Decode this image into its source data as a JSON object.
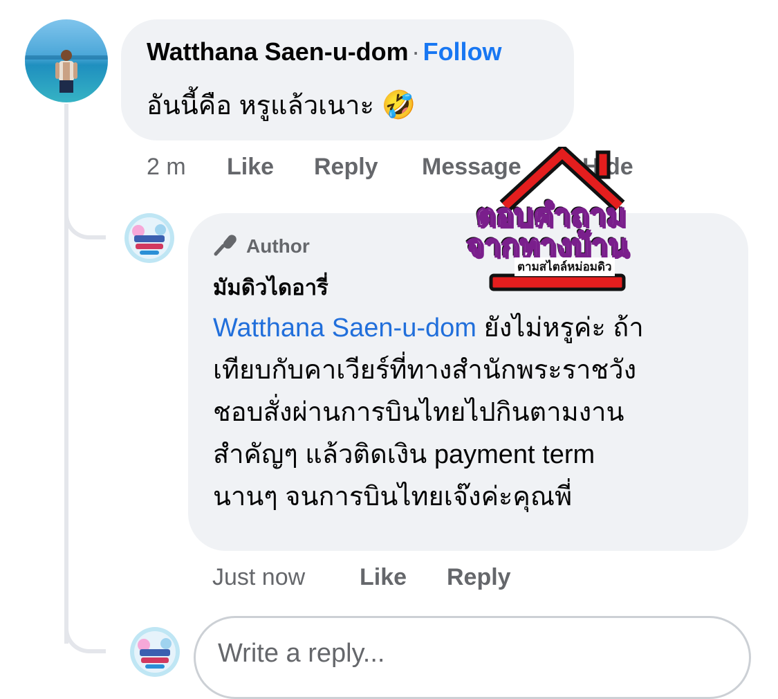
{
  "comment": {
    "author": "Watthana Saen-u-dom",
    "separator": "·",
    "follow_label": "Follow",
    "text": "อันนี้คือ หรูแล้วเนาะ",
    "emoji": "🤣",
    "emoji_icon": "rolling-laughing-emoji",
    "time": "2 m",
    "actions": {
      "like": "Like",
      "reply": "Reply",
      "message": "Message",
      "hide": "Hide"
    }
  },
  "overlay": {
    "line1": "ตอบคำถาม",
    "line2": "จากทางบ้าน",
    "line3": "ตามสไตล์หม่อมดิว",
    "colors": {
      "roof": "#e41e1e",
      "text_fill": "#ffffff",
      "text_outline": "#7a1f8c",
      "shadow": "#111111"
    }
  },
  "reply": {
    "badge_icon": "microphone-icon",
    "badge_label": "Author",
    "author": "มัมดิวไดอารี่",
    "mention": "Watthana Saen-u-dom",
    "lines": [
      " ยังไม่หรูค่ะ ถ้า",
      "เทียบกับคาเวียร์ที่ทางสำนักพระราชวัง",
      "ชอบสั่งผ่านการบินไทยไปกินตามงาน",
      "สำคัญๆ แล้วติดเงิน payment term",
      "นานๆ จนการบินไทยเจ๊งค่ะคุณพี่"
    ],
    "time": "Just now",
    "actions": {
      "like": "Like",
      "reply": "Reply"
    }
  },
  "composer": {
    "placeholder": "Write a reply..."
  },
  "colors": {
    "bubble": "#f0f2f5",
    "link": "#1877f2",
    "mention": "#216fdb",
    "muted": "#65676b",
    "thread_line": "#e4e6eb"
  }
}
